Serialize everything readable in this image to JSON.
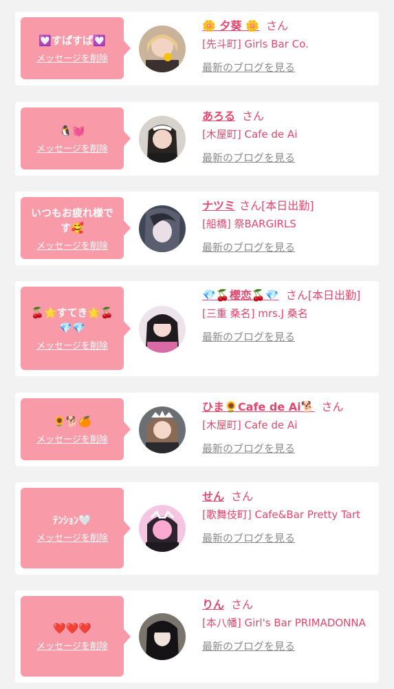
{
  "delete_label": "メッセージを削除",
  "blog_label": "最新のブログを見る",
  "colors": {
    "accent": "#e2476d",
    "bubble": "#f99aa9",
    "card": "#ffffff",
    "background": "#f2f2f2"
  },
  "items": [
    {
      "message": "💟すぱすぱ💟",
      "name": "🌼 夕葵 🌼",
      "suffix": "さん",
      "shop": "[先斗町] Girls Bar Co."
    },
    {
      "message": "🐧💓",
      "name": "あろる",
      "suffix": "さん",
      "shop": "[木屋町] Cafe de Ai"
    },
    {
      "message": "いつもお疲れ様です🥰",
      "name": "ナツミ",
      "suffix": "さん[本日出勤]",
      "shop": "[船橋] 祭BARGIRLS"
    },
    {
      "message": "🍒🌟すてき🌟🍒💎💎",
      "name": "💎🍒櫻恋🍒💎",
      "suffix": "さん[本日出勤]",
      "shop": "[三重 桑名] mrs.J 桑名"
    },
    {
      "message": "🌻🐕🍊",
      "name": "ひま🌻Cafe de Ai🐕",
      "suffix": "さん",
      "shop": "[木屋町] Cafe de Ai"
    },
    {
      "message": "ﾃﾝｼｮﾝ🤍",
      "name": "せん",
      "suffix": "さん",
      "shop": "[歌舞伎町] Cafe&Bar Pretty Tart"
    },
    {
      "message": "❤️❤️❤️",
      "name": "りん",
      "suffix": "さん",
      "shop": "[本八幡] Girl's Bar PRIMADONNA"
    }
  ]
}
